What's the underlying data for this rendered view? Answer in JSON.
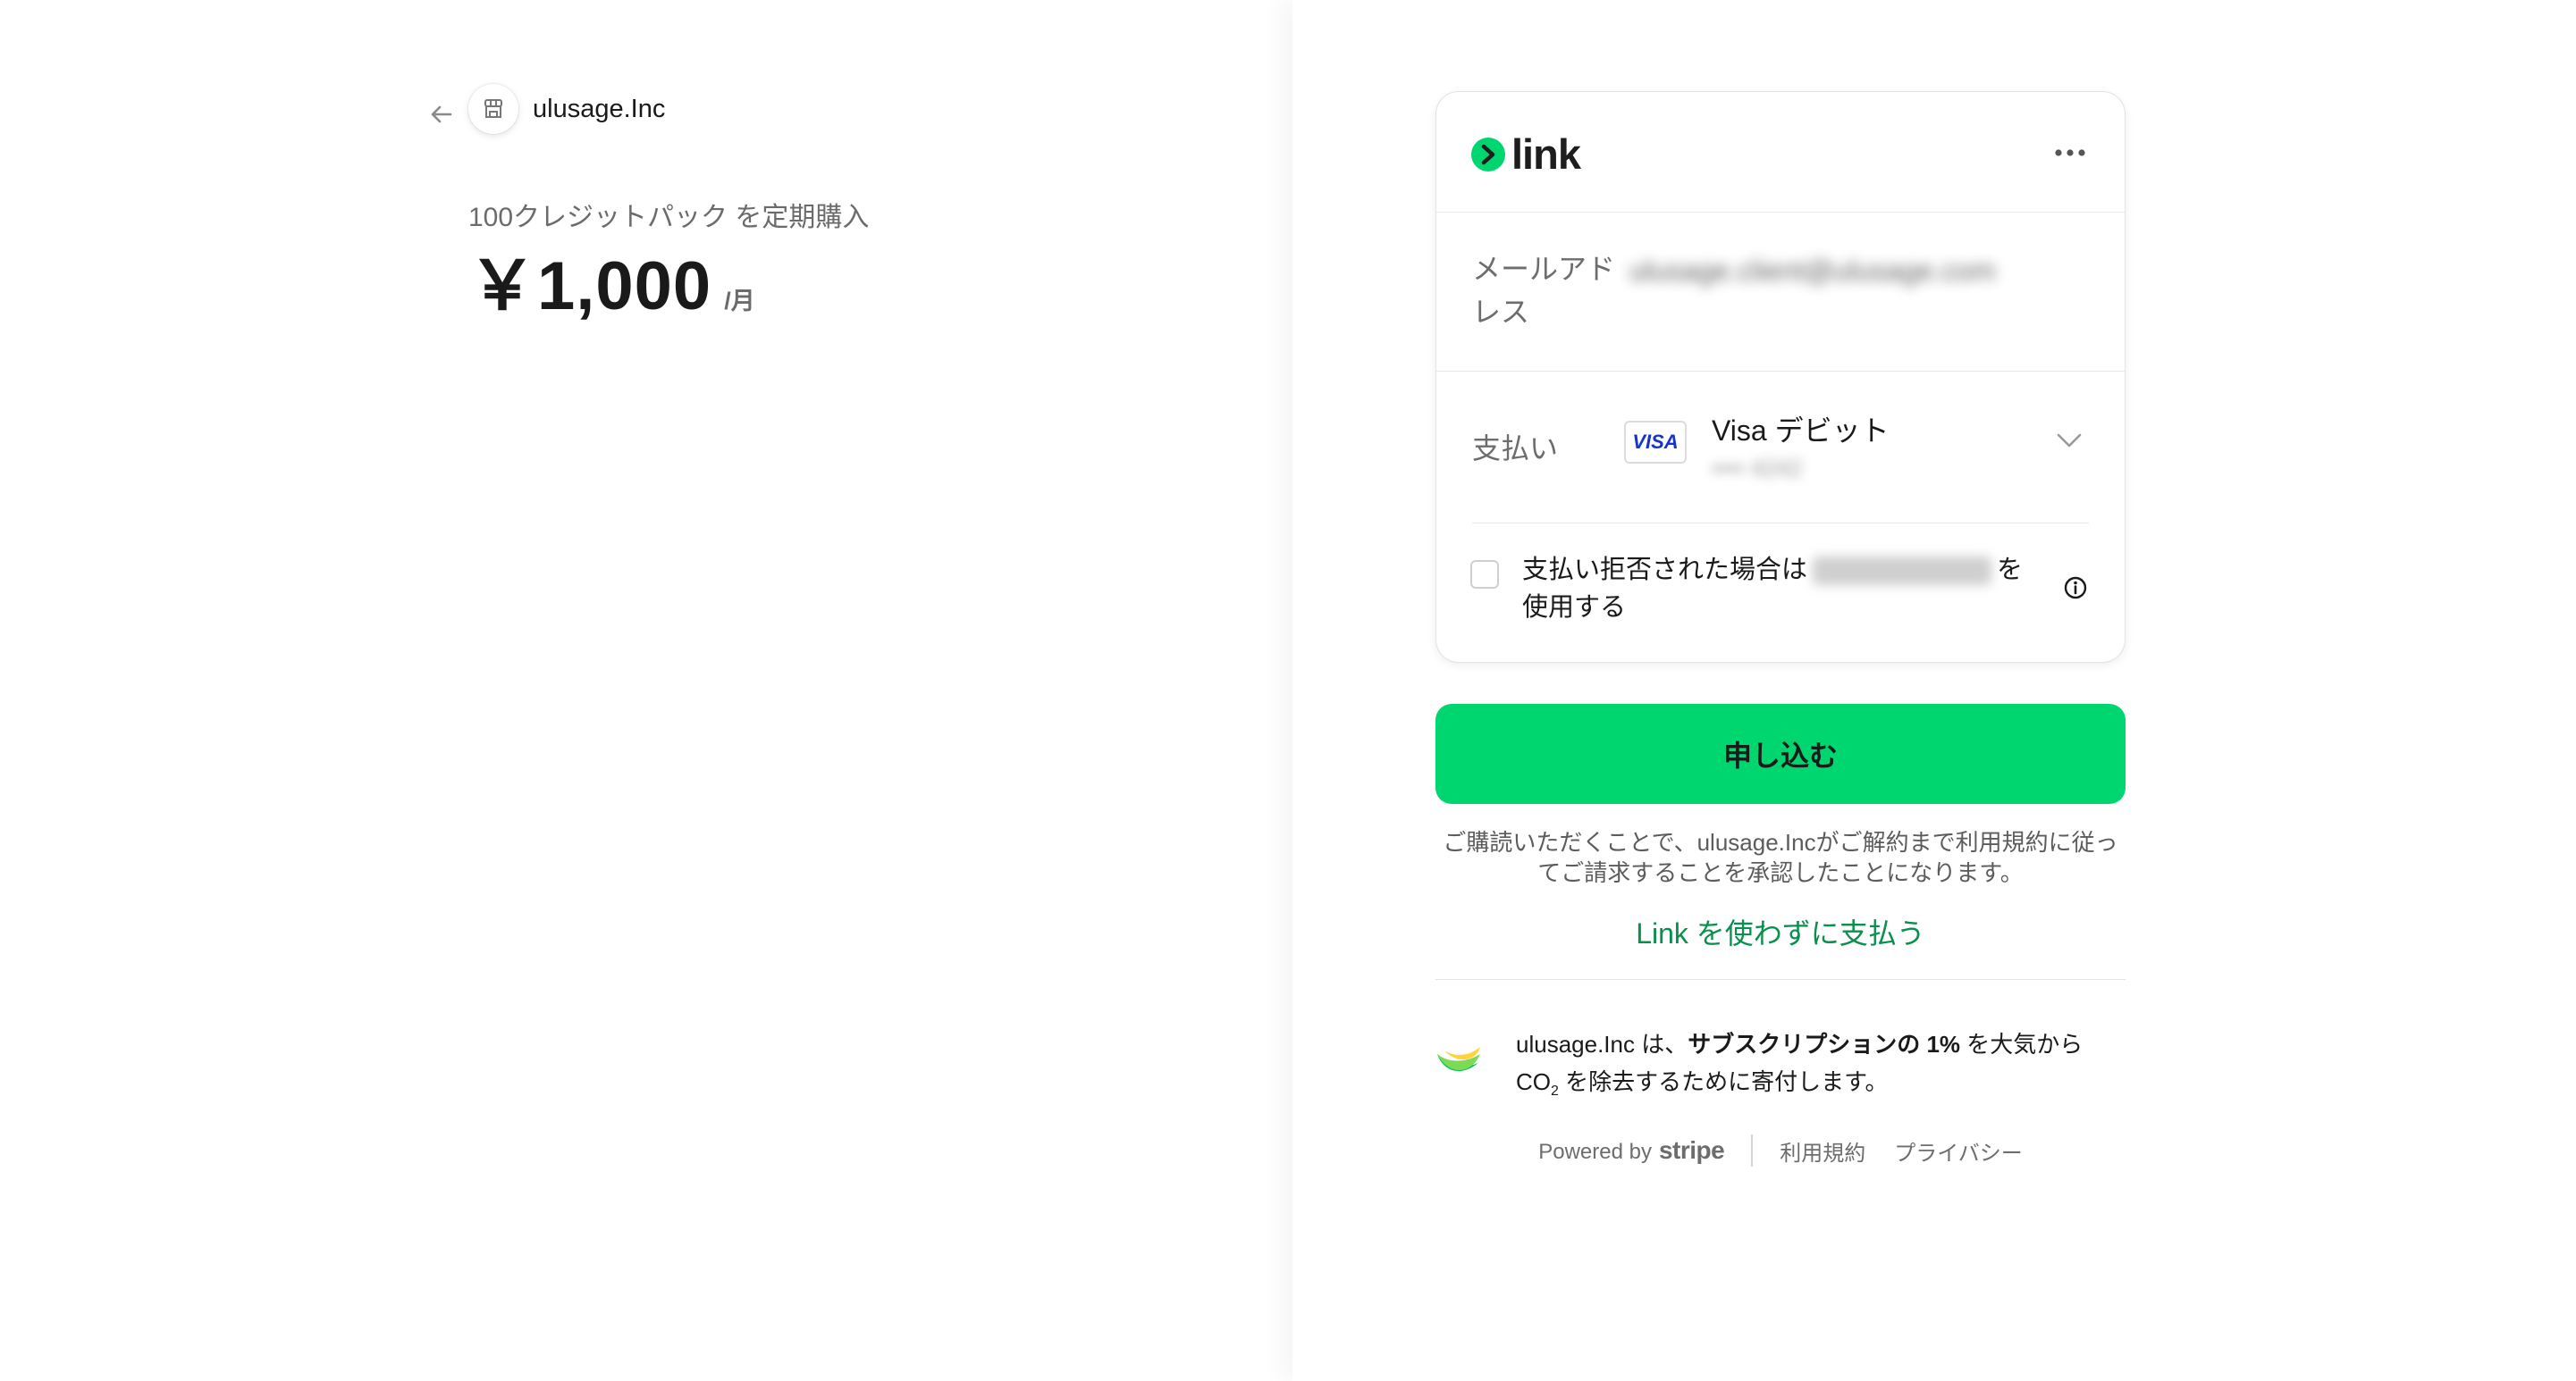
{
  "merchant": {
    "name": "ulusage.Inc"
  },
  "product": {
    "name": "100クレジットパック を定期購入",
    "price": "￥1,000",
    "price_unit": "/月"
  },
  "link_card": {
    "brand": "link",
    "email_label": "メールアドレス",
    "email_value": "ulusage.client@ulusage.com",
    "payment_label": "支払い",
    "card_brand": "VISA",
    "payment_method": "Visa デビット",
    "payment_masked": "•••• 4242",
    "fallback_prefix": "支払い拒否された場合は",
    "fallback_suffix": "を使用する"
  },
  "submit_button": {
    "label": "申し込む"
  },
  "terms_text": "ご購読いただくことで、ulusage.Incがご解約まで利用規約に従ってご請求することを承認したことになります。",
  "no_link_text": "Link を使わずに支払う",
  "climate": {
    "prefix": "ulusage.Inc は、",
    "bold": "サブスクリプションの 1%",
    "middle": " を大気から CO",
    "sub": "2",
    "suffix": " を除去するために寄付します。"
  },
  "footer": {
    "powered_by": "Powered by",
    "stripe": "stripe",
    "terms": "利用規約",
    "privacy": "プライバシー"
  },
  "colors": {
    "accent": "#00d66f",
    "link_text": "#0a8f4c",
    "visa_blue": "#1434cb"
  }
}
